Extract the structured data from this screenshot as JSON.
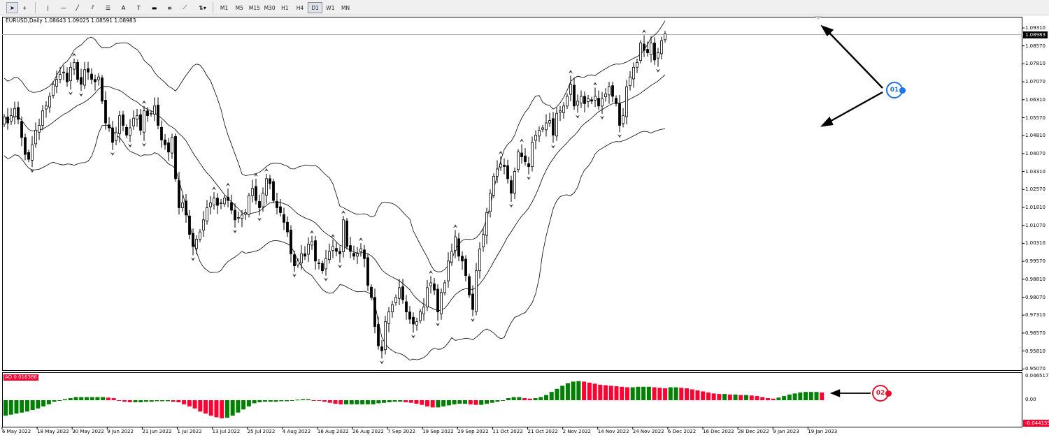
{
  "toolbar": {
    "tools": [
      {
        "name": "cursor-icon",
        "glyph": "➤"
      },
      {
        "name": "crosshair-icon",
        "glyph": "+"
      },
      {
        "name": "vertical-line-icon",
        "glyph": "|"
      },
      {
        "name": "horizontal-line-icon",
        "glyph": "—"
      },
      {
        "name": "trendline-icon",
        "glyph": "╱"
      },
      {
        "name": "equidistant-channel-icon",
        "glyph": "⫽"
      },
      {
        "name": "fibonacci-icon",
        "glyph": "☰"
      },
      {
        "name": "text-icon",
        "glyph": "A"
      },
      {
        "name": "text-label-icon",
        "glyph": "T"
      },
      {
        "name": "rectangle-icon",
        "glyph": "▬"
      },
      {
        "name": "fibonacci-fan-icon",
        "glyph": "≡"
      },
      {
        "name": "pitchfork-icon",
        "glyph": "⟋"
      },
      {
        "name": "arrows-menu-icon",
        "glyph": "⇅▾"
      }
    ],
    "timeframes": [
      "M1",
      "M5",
      "M15",
      "M30",
      "H1",
      "H4",
      "D1",
      "W1",
      "MN"
    ],
    "active_timeframe": "D1"
  },
  "header": {
    "symbol": "EURUSD,Daily",
    "ohlc": "1.08643 1.09025 1.08591 1.08983"
  },
  "price_axis": {
    "labels": [
      "1.09310",
      "1.08570",
      "1.07810",
      "1.07070",
      "1.06310",
      "1.05570",
      "1.04810",
      "1.04070",
      "1.03310",
      "1.02570",
      "1.01810",
      "1.01070",
      "1.00310",
      "0.99570",
      "0.98810",
      "0.98070",
      "0.97310",
      "0.96570",
      "0.95810",
      "0.95070"
    ],
    "current_price": "1.08983"
  },
  "ao": {
    "badge": "AO 0.016386",
    "max": "0.046517",
    "zero": "0.00",
    "min": "-0.044155"
  },
  "dates": [
    "6 May 2022",
    "18 May 2022",
    "30 May 2022",
    "9 Jun 2022",
    "21 Jun 2022",
    "1 Jul 2022",
    "13 Jul 2022",
    "25 Jul 2022",
    "4 Aug 2022",
    "16 Aug 2022",
    "26 Aug 2022",
    "7 Sep 2022",
    "19 Sep 2022",
    "29 Sep 2022",
    "11 Oct 2022",
    "21 Oct 2022",
    "2 Nov 2022",
    "14 Nov 2022",
    "24 Nov 2022",
    "6 Dec 2022",
    "16 Dec 2022",
    "28 Dec 2022",
    "9 Jan 2023",
    "19 Jan 2023"
  ],
  "annotations": {
    "marker1": "01",
    "marker2": "02"
  },
  "colors": {
    "ao_up": "#008000",
    "ao_down": "#ff0033",
    "marker1": "#1a73e8",
    "marker2": "#e8112d",
    "bull_body": "#ffffff",
    "bear_body": "#000000"
  },
  "chart_data": {
    "type": "candlestick",
    "symbol": "EURUSD",
    "timeframe": "Daily",
    "indicators": [
      "Bollinger Bands (20)",
      "Fractals",
      "Awesome Oscillator"
    ],
    "closes": [
      1.0555,
      1.053,
      1.056,
      1.059,
      1.0545,
      1.047,
      1.04,
      1.038,
      1.044,
      1.05,
      1.052,
      1.058,
      1.06,
      1.064,
      1.069,
      1.071,
      1.073,
      1.074,
      1.07,
      1.076,
      1.078,
      1.071,
      1.069,
      1.075,
      1.074,
      1.071,
      1.07,
      1.072,
      1.062,
      1.053,
      1.051,
      1.045,
      1.049,
      1.056,
      1.052,
      1.048,
      1.051,
      1.055,
      1.056,
      1.05,
      1.058,
      1.056,
      1.057,
      1.06,
      1.052,
      1.046,
      1.044,
      1.041,
      1.047,
      1.03,
      1.018,
      1.02,
      1.015,
      1.007,
      1.002,
      1.005,
      1.008,
      1.013,
      1.018,
      1.02,
      1.022,
      1.019,
      1.02,
      1.022,
      1.021,
      1.017,
      1.013,
      1.014,
      1.015,
      1.016,
      1.023,
      1.026,
      1.021,
      1.018,
      1.024,
      1.03,
      1.028,
      1.021,
      1.018,
      1.016,
      1.012,
      1.008,
      0.999,
      0.994,
      0.996,
      0.999,
      0.998,
      1.003,
      1.004,
      0.996,
      0.995,
      0.992,
      0.997,
      1.0,
      1.002,
      1.0,
      0.999,
      1.013,
      1.002,
      1.0,
      0.998,
      0.999,
      1.001,
      0.997,
      0.986,
      0.981,
      0.969,
      0.961,
      0.959,
      0.971,
      0.975,
      0.978,
      0.981,
      0.985,
      0.98,
      0.975,
      0.972,
      0.97,
      0.971,
      0.975,
      0.977,
      0.985,
      0.987,
      0.984,
      0.975,
      0.983,
      0.987,
      0.996,
      1.0,
      1.006,
      0.998,
      0.996,
      0.99,
      0.982,
      0.976,
      0.992,
      1.001,
      1.007,
      1.016,
      1.024,
      1.031,
      1.034,
      1.036,
      1.035,
      1.03,
      1.024,
      1.033,
      1.041,
      1.039,
      1.037,
      1.035,
      1.045,
      1.048,
      1.05,
      1.051,
      1.053,
      1.054,
      1.048,
      1.057,
      1.058,
      1.06,
      1.064,
      1.069,
      1.06,
      1.062,
      1.064,
      1.061,
      1.063,
      1.062,
      1.064,
      1.06,
      1.063,
      1.065,
      1.068,
      1.064,
      1.061,
      1.052,
      1.056,
      1.068,
      1.072,
      1.076,
      1.078,
      1.086,
      1.083,
      1.082,
      1.086,
      1.079,
      1.082,
      1.087,
      1.0898
    ],
    "ao_histogram": [
      -0.03,
      -0.028,
      -0.026,
      -0.024,
      -0.022,
      -0.019,
      -0.016,
      -0.012,
      -0.008,
      -0.003,
      0.0,
      0.002,
      0.004,
      0.006,
      0.006,
      0.006,
      0.006,
      0.006,
      0.006,
      0.005,
      0.004,
      0.0,
      -0.003,
      -0.004,
      -0.004,
      -0.004,
      -0.003,
      -0.003,
      -0.002,
      -0.002,
      -0.002,
      -0.003,
      -0.004,
      -0.008,
      -0.012,
      -0.016,
      -0.022,
      -0.026,
      -0.03,
      -0.033,
      -0.035,
      -0.034,
      -0.03,
      -0.024,
      -0.018,
      -0.012,
      -0.006,
      -0.004,
      -0.003,
      -0.003,
      -0.003,
      -0.002,
      -0.002,
      0.0,
      0.001,
      0.002,
      0.002,
      0.0,
      -0.001,
      -0.003,
      -0.005,
      -0.007,
      -0.008,
      -0.008,
      -0.008,
      -0.008,
      -0.008,
      -0.008,
      -0.008,
      -0.006,
      -0.005,
      -0.004,
      -0.003,
      -0.003,
      -0.004,
      -0.005,
      -0.007,
      -0.009,
      -0.012,
      -0.014,
      -0.014,
      -0.012,
      -0.01,
      -0.008,
      -0.007,
      -0.007,
      -0.008,
      -0.009,
      -0.009,
      -0.007,
      -0.005,
      -0.003,
      -0.001,
      0.004,
      0.006,
      0.006,
      0.004,
      0.003,
      0.004,
      0.006,
      0.01,
      0.016,
      0.022,
      0.028,
      0.033,
      0.036,
      0.037,
      0.036,
      0.034,
      0.032,
      0.03,
      0.029,
      0.028,
      0.027,
      0.026,
      0.025,
      0.025,
      0.026,
      0.026,
      0.026,
      0.025,
      0.024,
      0.023,
      0.025,
      0.025,
      0.024,
      0.023,
      0.021,
      0.019,
      0.017,
      0.015,
      0.013,
      0.012,
      0.012,
      0.011,
      0.011,
      0.01,
      0.01,
      0.009,
      0.008,
      0.006,
      0.004,
      0.003,
      0.005,
      0.008,
      0.011,
      0.013,
      0.015,
      0.016,
      0.016,
      0.016,
      0.015
    ]
  }
}
